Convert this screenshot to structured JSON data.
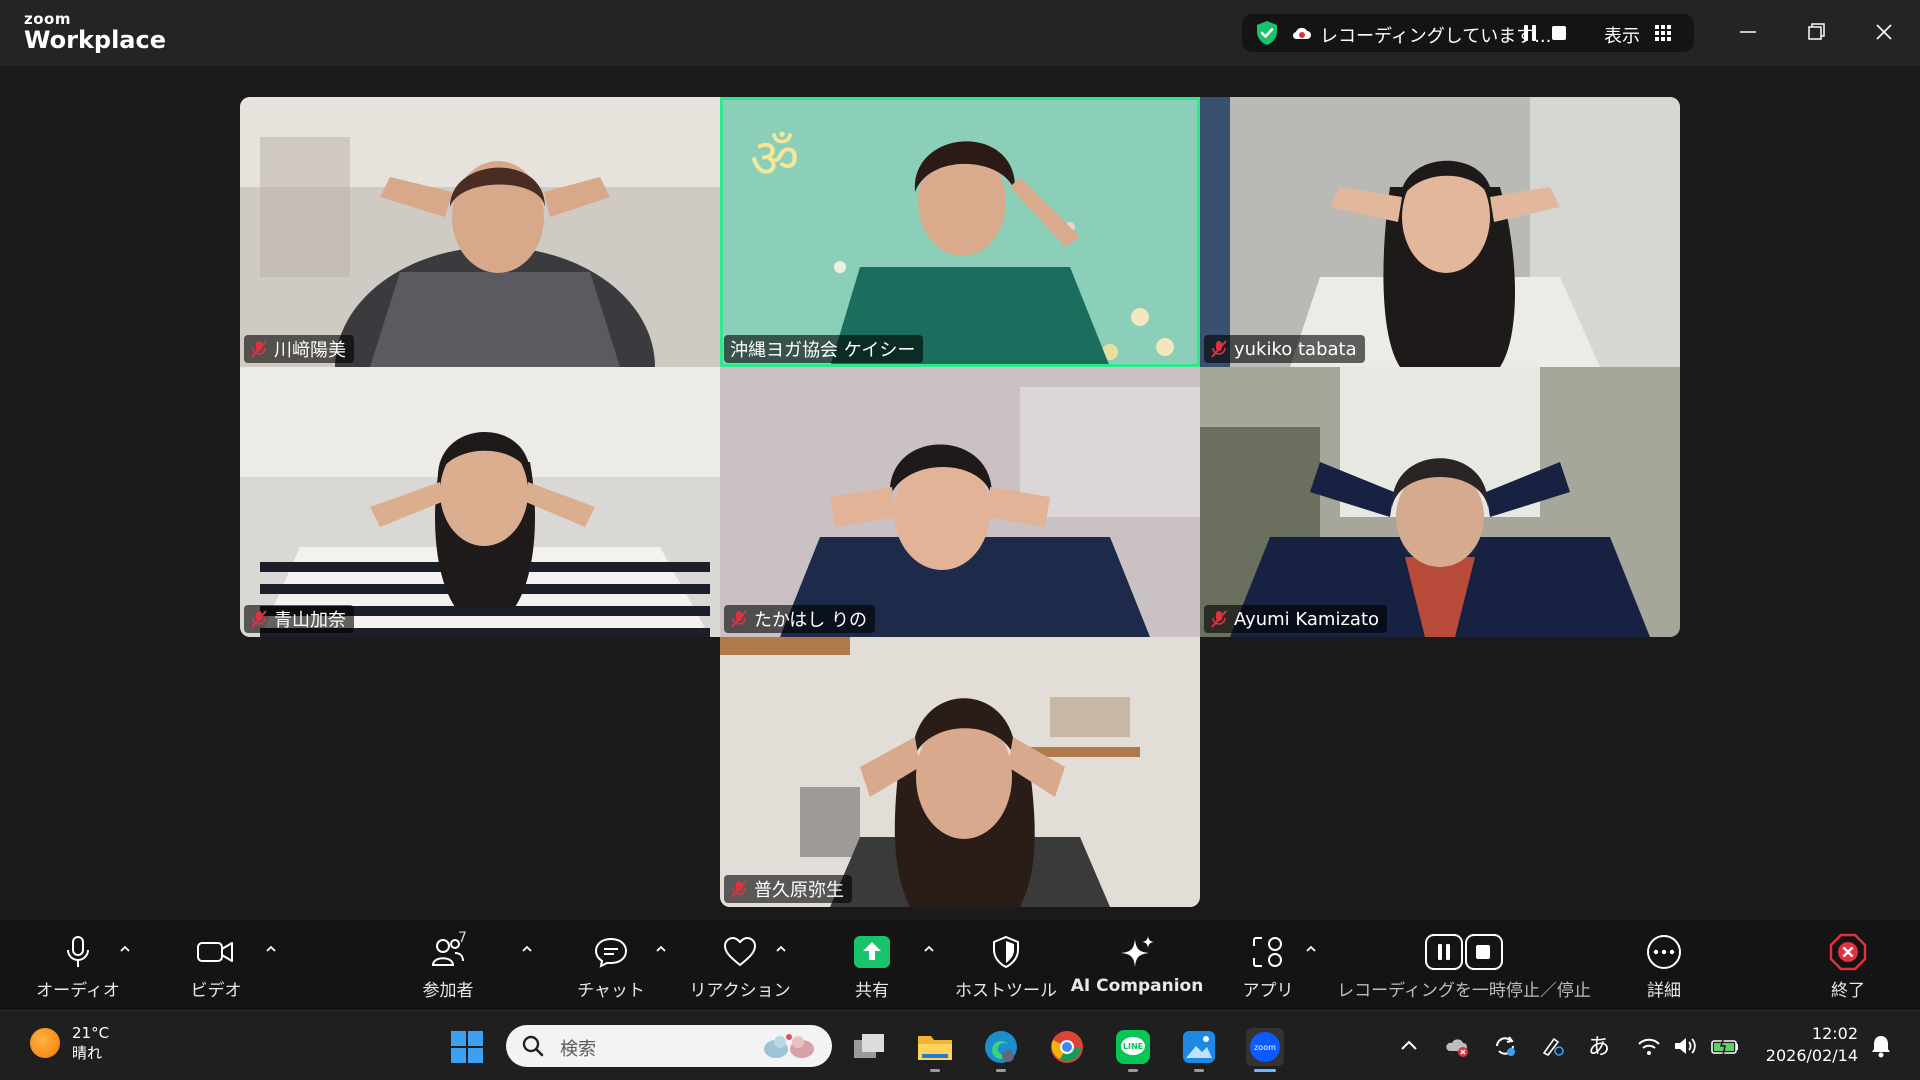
{
  "app": {
    "logo_small": "zoom",
    "logo_big": "Workplace"
  },
  "recording_bar": {
    "status_text": "レコーディングしています...",
    "view_label": "表示"
  },
  "participants": [
    {
      "name": "川﨑陽美",
      "muted": true,
      "active": false
    },
    {
      "name": "沖縄ヨガ協会  ケイシー",
      "muted": false,
      "active": true
    },
    {
      "name": "yukiko tabata",
      "muted": true,
      "active": false
    },
    {
      "name": "青山加奈",
      "muted": true,
      "active": false
    },
    {
      "name": "たかはし  りの",
      "muted": true,
      "active": false
    },
    {
      "name": "Ayumi Kamizato",
      "muted": true,
      "active": false
    },
    {
      "name": "普久原弥生",
      "muted": true,
      "active": false
    }
  ],
  "toolbar": {
    "audio_label": "オーディオ",
    "video_label": "ビデオ",
    "participants_label": "参加者",
    "participants_count": "7",
    "chat_label": "チャット",
    "reactions_label": "リアクション",
    "share_label": "共有",
    "host_tools_label": "ホストツール",
    "ai_companion_label": "AI Companion",
    "apps_label": "アプリ",
    "recording_label": "レコーディングを一時停止／停止",
    "more_label": "詳細",
    "end_label": "終了"
  },
  "taskbar": {
    "weather_temp": "21°C",
    "weather_desc": "晴れ",
    "search_placeholder": "検索",
    "ime_indicator": "あ",
    "time": "12:02",
    "date": "2026/02/14"
  },
  "colors": {
    "active_speaker_border": "#2ee88d",
    "share_green": "#19c36b",
    "end_red": "#e0313f",
    "mute_red": "#e0313f"
  }
}
